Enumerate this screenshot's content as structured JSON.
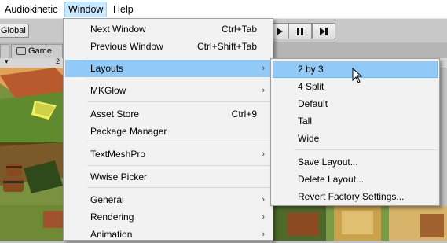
{
  "menubar": {
    "items": [
      {
        "label": "Audiokinetic"
      },
      {
        "label": "Window"
      },
      {
        "label": "Help"
      }
    ]
  },
  "toolbar": {
    "global_label": "Global",
    "play_controls": [
      "play-icon",
      "pause-icon",
      "step-icon"
    ]
  },
  "tabs": {
    "game_label": "Game"
  },
  "ruler": {
    "left_value": "2"
  },
  "window_menu": {
    "items": [
      {
        "label": "Next Window",
        "shortcut": "Ctrl+Tab"
      },
      {
        "label": "Previous Window",
        "shortcut": "Ctrl+Shift+Tab"
      },
      {
        "label": "Layouts",
        "submenu": true
      },
      {
        "label": "MKGlow",
        "submenu": true
      },
      {
        "label": "Asset Store",
        "shortcut": "Ctrl+9"
      },
      {
        "label": "Package Manager"
      },
      {
        "label": "TextMeshPro",
        "submenu": true
      },
      {
        "label": "Wwise Picker"
      },
      {
        "label": "General",
        "submenu": true
      },
      {
        "label": "Rendering",
        "submenu": true
      },
      {
        "label": "Animation",
        "submenu": true
      }
    ]
  },
  "layouts_submenu": {
    "items": [
      {
        "label": "2 by 3"
      },
      {
        "label": "4 Split"
      },
      {
        "label": "Default"
      },
      {
        "label": "Tall"
      },
      {
        "label": "Wide"
      },
      {
        "label": "Save Layout..."
      },
      {
        "label": "Delete Layout..."
      },
      {
        "label": "Revert Factory Settings..."
      }
    ]
  },
  "colors": {
    "highlight": "#91c9f7",
    "menubar_active": "#cce8ff",
    "menu_bg": "#f2f2f2"
  }
}
